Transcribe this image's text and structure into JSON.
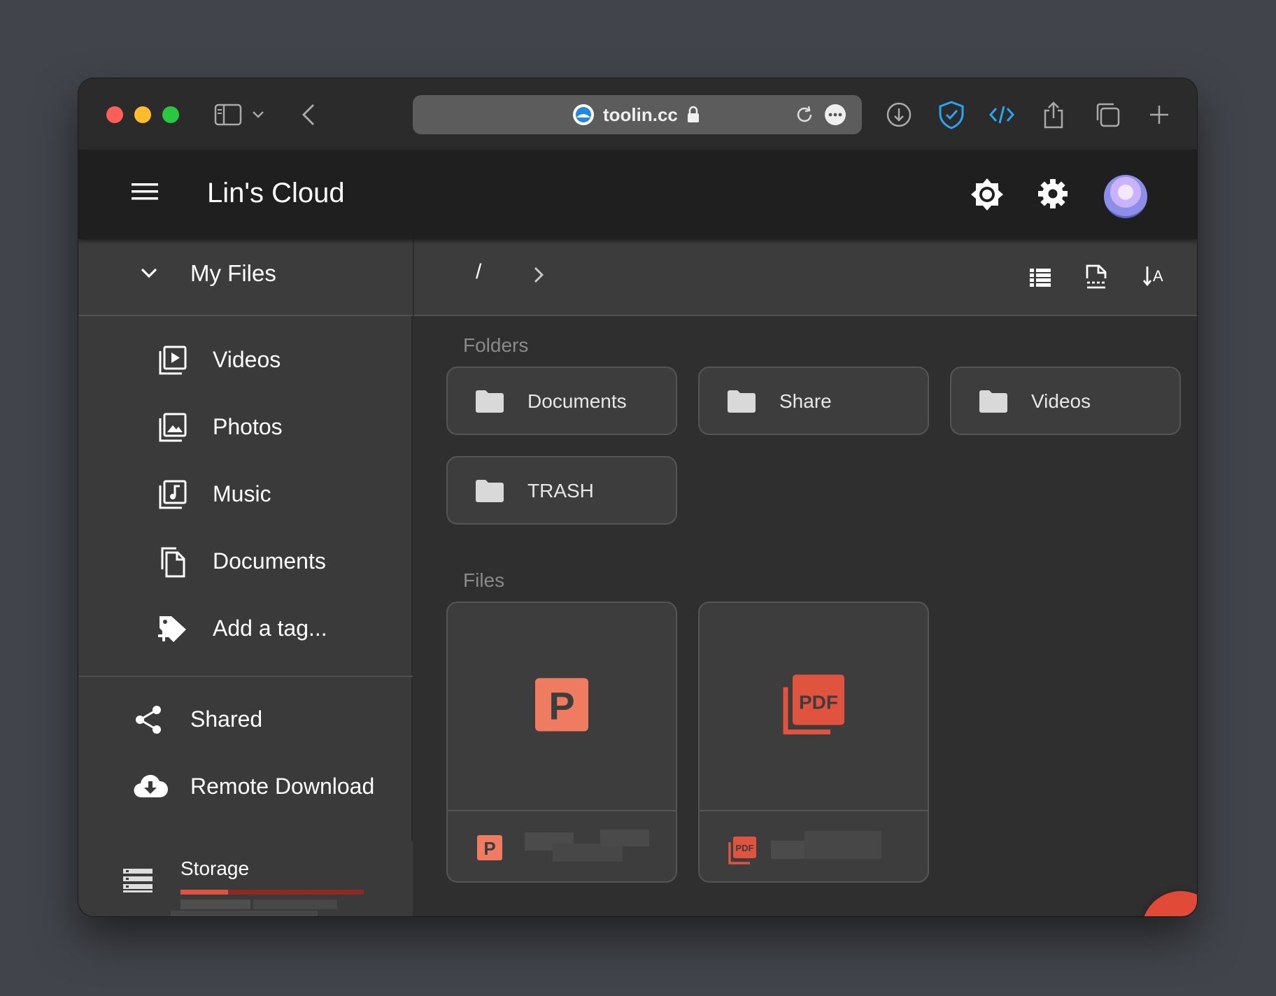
{
  "browser": {
    "url": "toolin.cc",
    "icons": [
      "sidebar-icon",
      "chevron-down-icon",
      "back-icon",
      "reload-icon",
      "more-icon",
      "download-icon",
      "shield-icon",
      "code-icon",
      "share-icon",
      "tabs-icon",
      "new-tab-icon"
    ]
  },
  "app": {
    "title": "Lin's Cloud",
    "icons": [
      "menu-icon",
      "brightness-icon",
      "settings-icon",
      "avatar"
    ]
  },
  "sidebar": {
    "header": "My Files",
    "items": [
      {
        "label": "Videos",
        "icon": "video-library-icon"
      },
      {
        "label": "Photos",
        "icon": "photo-library-icon"
      },
      {
        "label": "Music",
        "icon": "music-library-icon"
      },
      {
        "label": "Documents",
        "icon": "documents-icon"
      },
      {
        "label": "Add a tag...",
        "icon": "add-tag-icon"
      }
    ],
    "shared": {
      "label": "Shared",
      "icon": "share-icon"
    },
    "remote": {
      "label": "Remote Download",
      "icon": "cloud-download-icon"
    },
    "storage": {
      "label": "Storage",
      "icon": "storage-icon",
      "used_fraction": 0.26
    }
  },
  "main": {
    "breadcrumb": "/",
    "toolbar_icons": [
      "list-view-icon",
      "select-icon",
      "sort-icon"
    ],
    "folders_title": "Folders",
    "folders": [
      "Documents",
      "Share",
      "Videos",
      "TRASH"
    ],
    "files_title": "Files",
    "files": [
      {
        "type": "ppt",
        "icon_letter": "P"
      },
      {
        "type": "pdf",
        "icon_letter": "PDF"
      }
    ]
  },
  "colors": {
    "accent": "#e04a36",
    "ppt": "#ef7b61",
    "pdf": "#e0533f"
  }
}
